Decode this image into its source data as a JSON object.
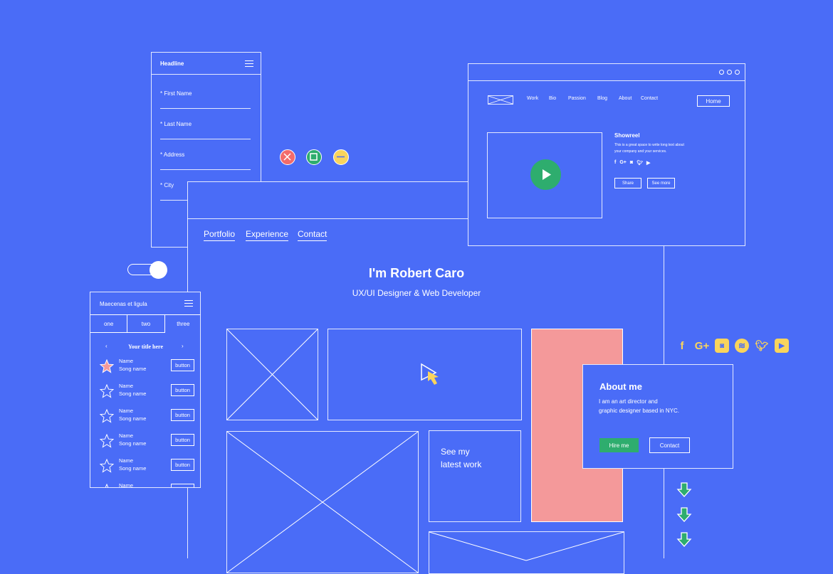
{
  "colors": {
    "background": "#4a6cf7",
    "green": "#2ead6e",
    "red": "#f26b6b",
    "yellow": "#f9d45c",
    "pink": "#f4999a"
  },
  "form_panel": {
    "title": "Headline",
    "fields": [
      "* First Name",
      "* Last Name",
      "* Address",
      "* City"
    ]
  },
  "window_controls": [
    "close-icon",
    "maximize-icon",
    "minimize-icon"
  ],
  "main": {
    "nav": [
      "Portfolio",
      "Experience",
      "Contact"
    ],
    "title": "I'm Robert Caro",
    "subtitle": "UX/UI Designer & Web Developer",
    "tile_text": "See my\nlatest work"
  },
  "site_window": {
    "nav": [
      "Work",
      "Bio",
      "Passion",
      "Blog",
      "About",
      "Contact"
    ],
    "home_button": "Home",
    "showreel_title": "Showreel",
    "showreel_text": "This is a great space to write long text about your company and your services.",
    "share_button": "Share",
    "see_more_button": "See more",
    "social_icons": [
      "facebook-icon",
      "google-plus-icon",
      "instagram-icon",
      "twitter-icon",
      "youtube-icon"
    ]
  },
  "social_icons": [
    "facebook-icon",
    "google-plus-icon",
    "instagram-icon",
    "spotify-icon",
    "twitter-icon",
    "youtube-icon"
  ],
  "about": {
    "title": "About me",
    "text_line1": "I am an art director and",
    "text_line2": "graphic designer based in NYC.",
    "hire_button": "Hire me",
    "contact_button": "Contact"
  },
  "mobile": {
    "title": "Maecenas et ligula",
    "tabs": [
      "one",
      "two",
      "three"
    ],
    "list_title": "Your title here",
    "items": [
      {
        "name": "Name",
        "song": "Song name",
        "button": "button",
        "starred": true
      },
      {
        "name": "Name",
        "song": "Song name",
        "button": "button",
        "starred": false
      },
      {
        "name": "Name",
        "song": "Song name",
        "button": "button",
        "starred": false
      },
      {
        "name": "Name",
        "song": "Song name",
        "button": "button",
        "starred": false
      },
      {
        "name": "Name",
        "song": "Song name",
        "button": "button",
        "starred": false
      },
      {
        "name": "Name",
        "song": "",
        "button": "",
        "starred": false
      }
    ]
  }
}
